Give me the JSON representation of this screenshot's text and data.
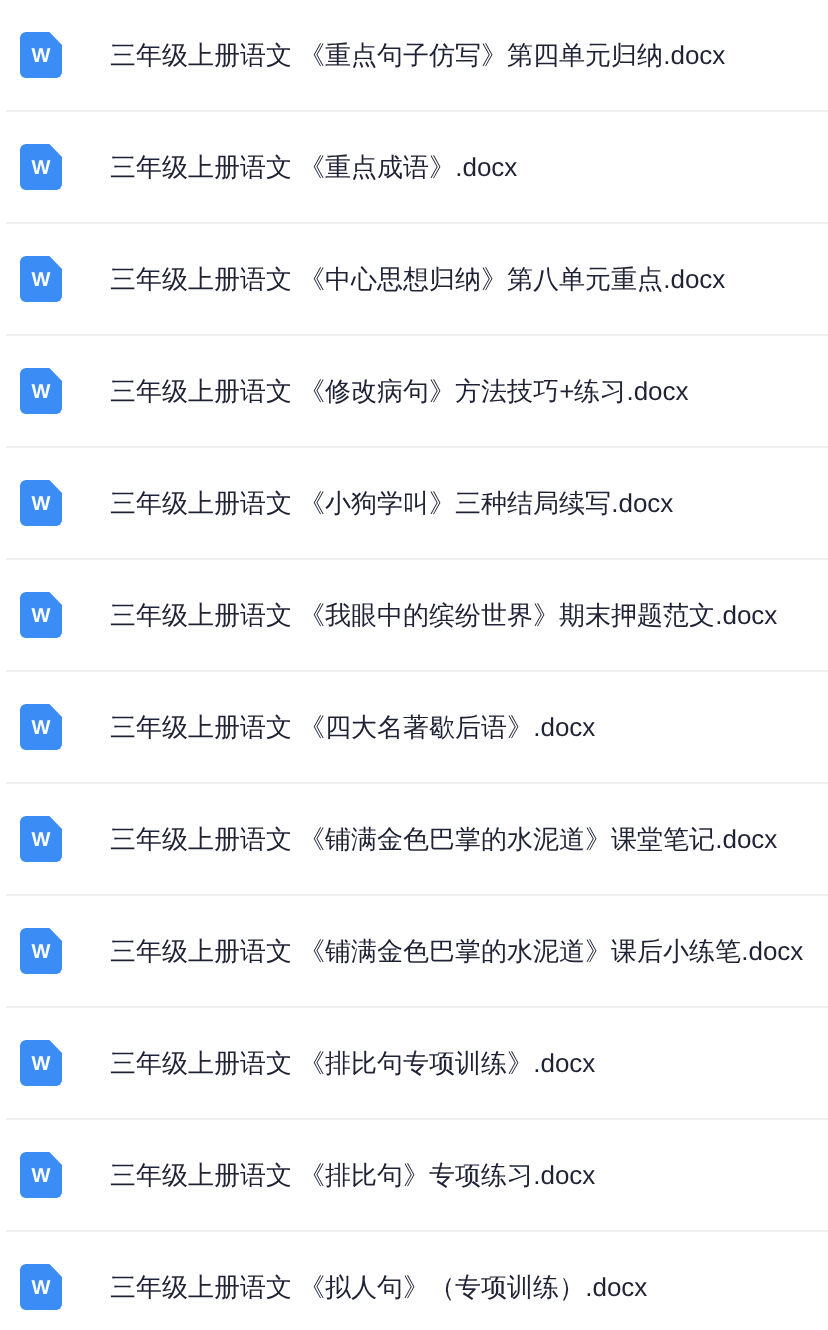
{
  "files": [
    {
      "icon_letter": "W",
      "name": "三年级上册语文 《重点句子仿写》第四单元归纳.docx"
    },
    {
      "icon_letter": "W",
      "name": "三年级上册语文 《重点成语》.docx"
    },
    {
      "icon_letter": "W",
      "name": "三年级上册语文 《中心思想归纳》第八单元重点.docx"
    },
    {
      "icon_letter": "W",
      "name": "三年级上册语文 《修改病句》方法技巧+练习.docx"
    },
    {
      "icon_letter": "W",
      "name": "三年级上册语文 《小狗学叫》三种结局续写.docx"
    },
    {
      "icon_letter": "W",
      "name": "三年级上册语文 《我眼中的缤纷世界》期末押题范文.docx"
    },
    {
      "icon_letter": "W",
      "name": "三年级上册语文 《四大名著歇后语》.docx"
    },
    {
      "icon_letter": "W",
      "name": "三年级上册语文 《铺满金色巴掌的水泥道》课堂笔记.docx"
    },
    {
      "icon_letter": "W",
      "name": "三年级上册语文 《铺满金色巴掌的水泥道》课后小练笔.docx"
    },
    {
      "icon_letter": "W",
      "name": "三年级上册语文 《排比句专项训练》.docx"
    },
    {
      "icon_letter": "W",
      "name": "三年级上册语文 《排比句》专项练习.docx"
    },
    {
      "icon_letter": "W",
      "name": "三年级上册语文 《拟人句》（专项训练）.docx"
    }
  ]
}
